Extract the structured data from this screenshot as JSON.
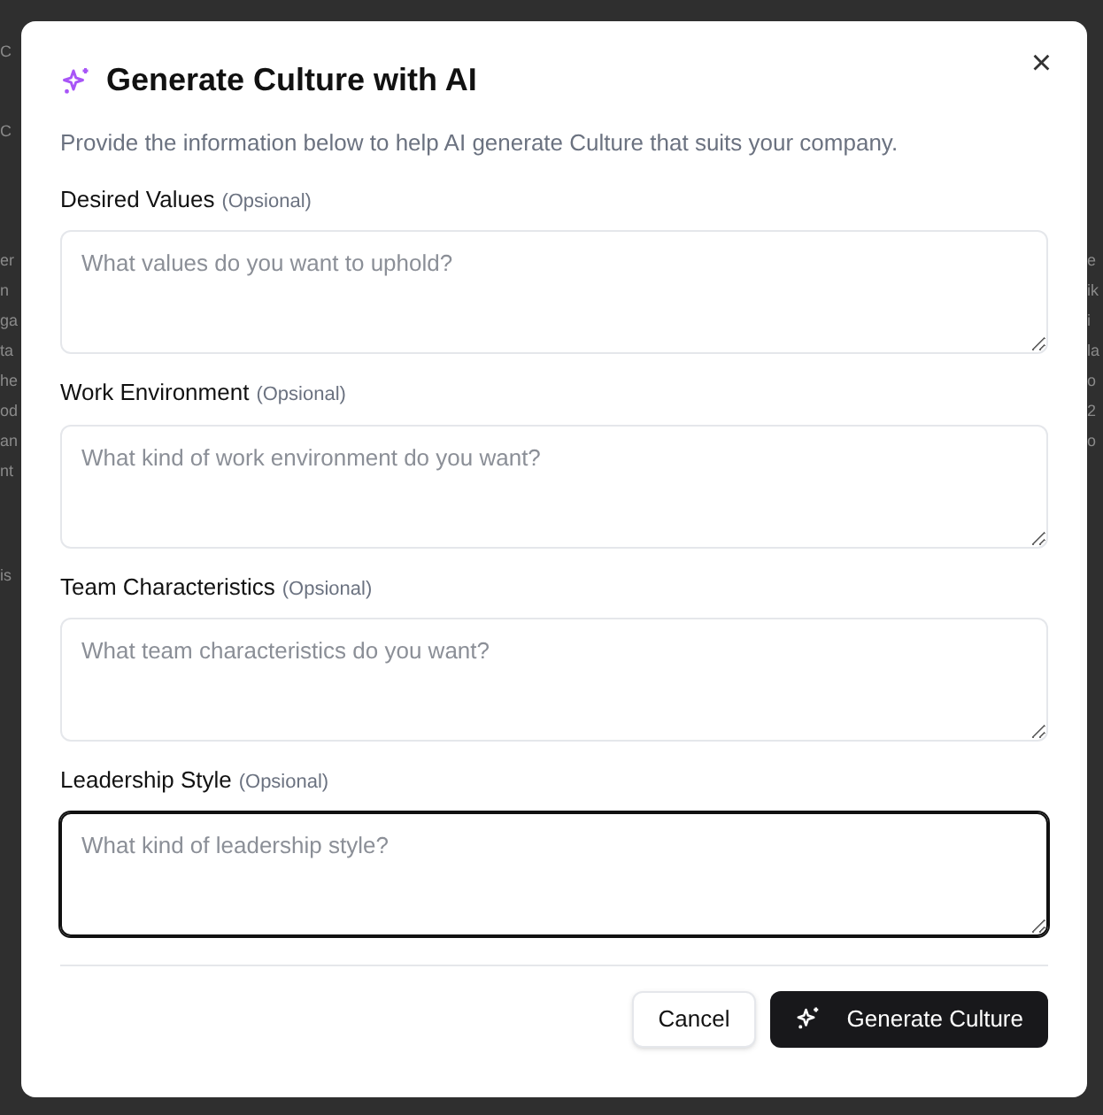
{
  "background": {
    "left_fragments": [
      "C",
      "C",
      "er",
      "n",
      "ga",
      "ta",
      "he",
      "od",
      "an",
      "nt",
      "is"
    ],
    "right_fragments": [
      "e",
      "ik",
      "i",
      "la",
      "o",
      "2",
      "o"
    ]
  },
  "dialog": {
    "title": "Generate Culture with AI",
    "description": "Provide the information below to help AI generate Culture that suits your company.",
    "close": "×",
    "fields": [
      {
        "label": "Desired Values",
        "hint": "(Opsional)",
        "placeholder": "What values do you want to uphold?",
        "focused": false
      },
      {
        "label": "Work Environment",
        "hint": "(Opsional)",
        "placeholder": "What kind of work environment do you want?",
        "focused": false
      },
      {
        "label": "Team Characteristics",
        "hint": "(Opsional)",
        "placeholder": "What team characteristics do you want?",
        "focused": false
      },
      {
        "label": "Leadership Style",
        "hint": "(Opsional)",
        "placeholder": "What kind of leadership style?",
        "focused": true
      }
    ],
    "buttons": [
      {
        "label": "Cancel",
        "kind": "secondary"
      },
      {
        "label": "Generate Culture",
        "kind": "primary"
      }
    ]
  }
}
